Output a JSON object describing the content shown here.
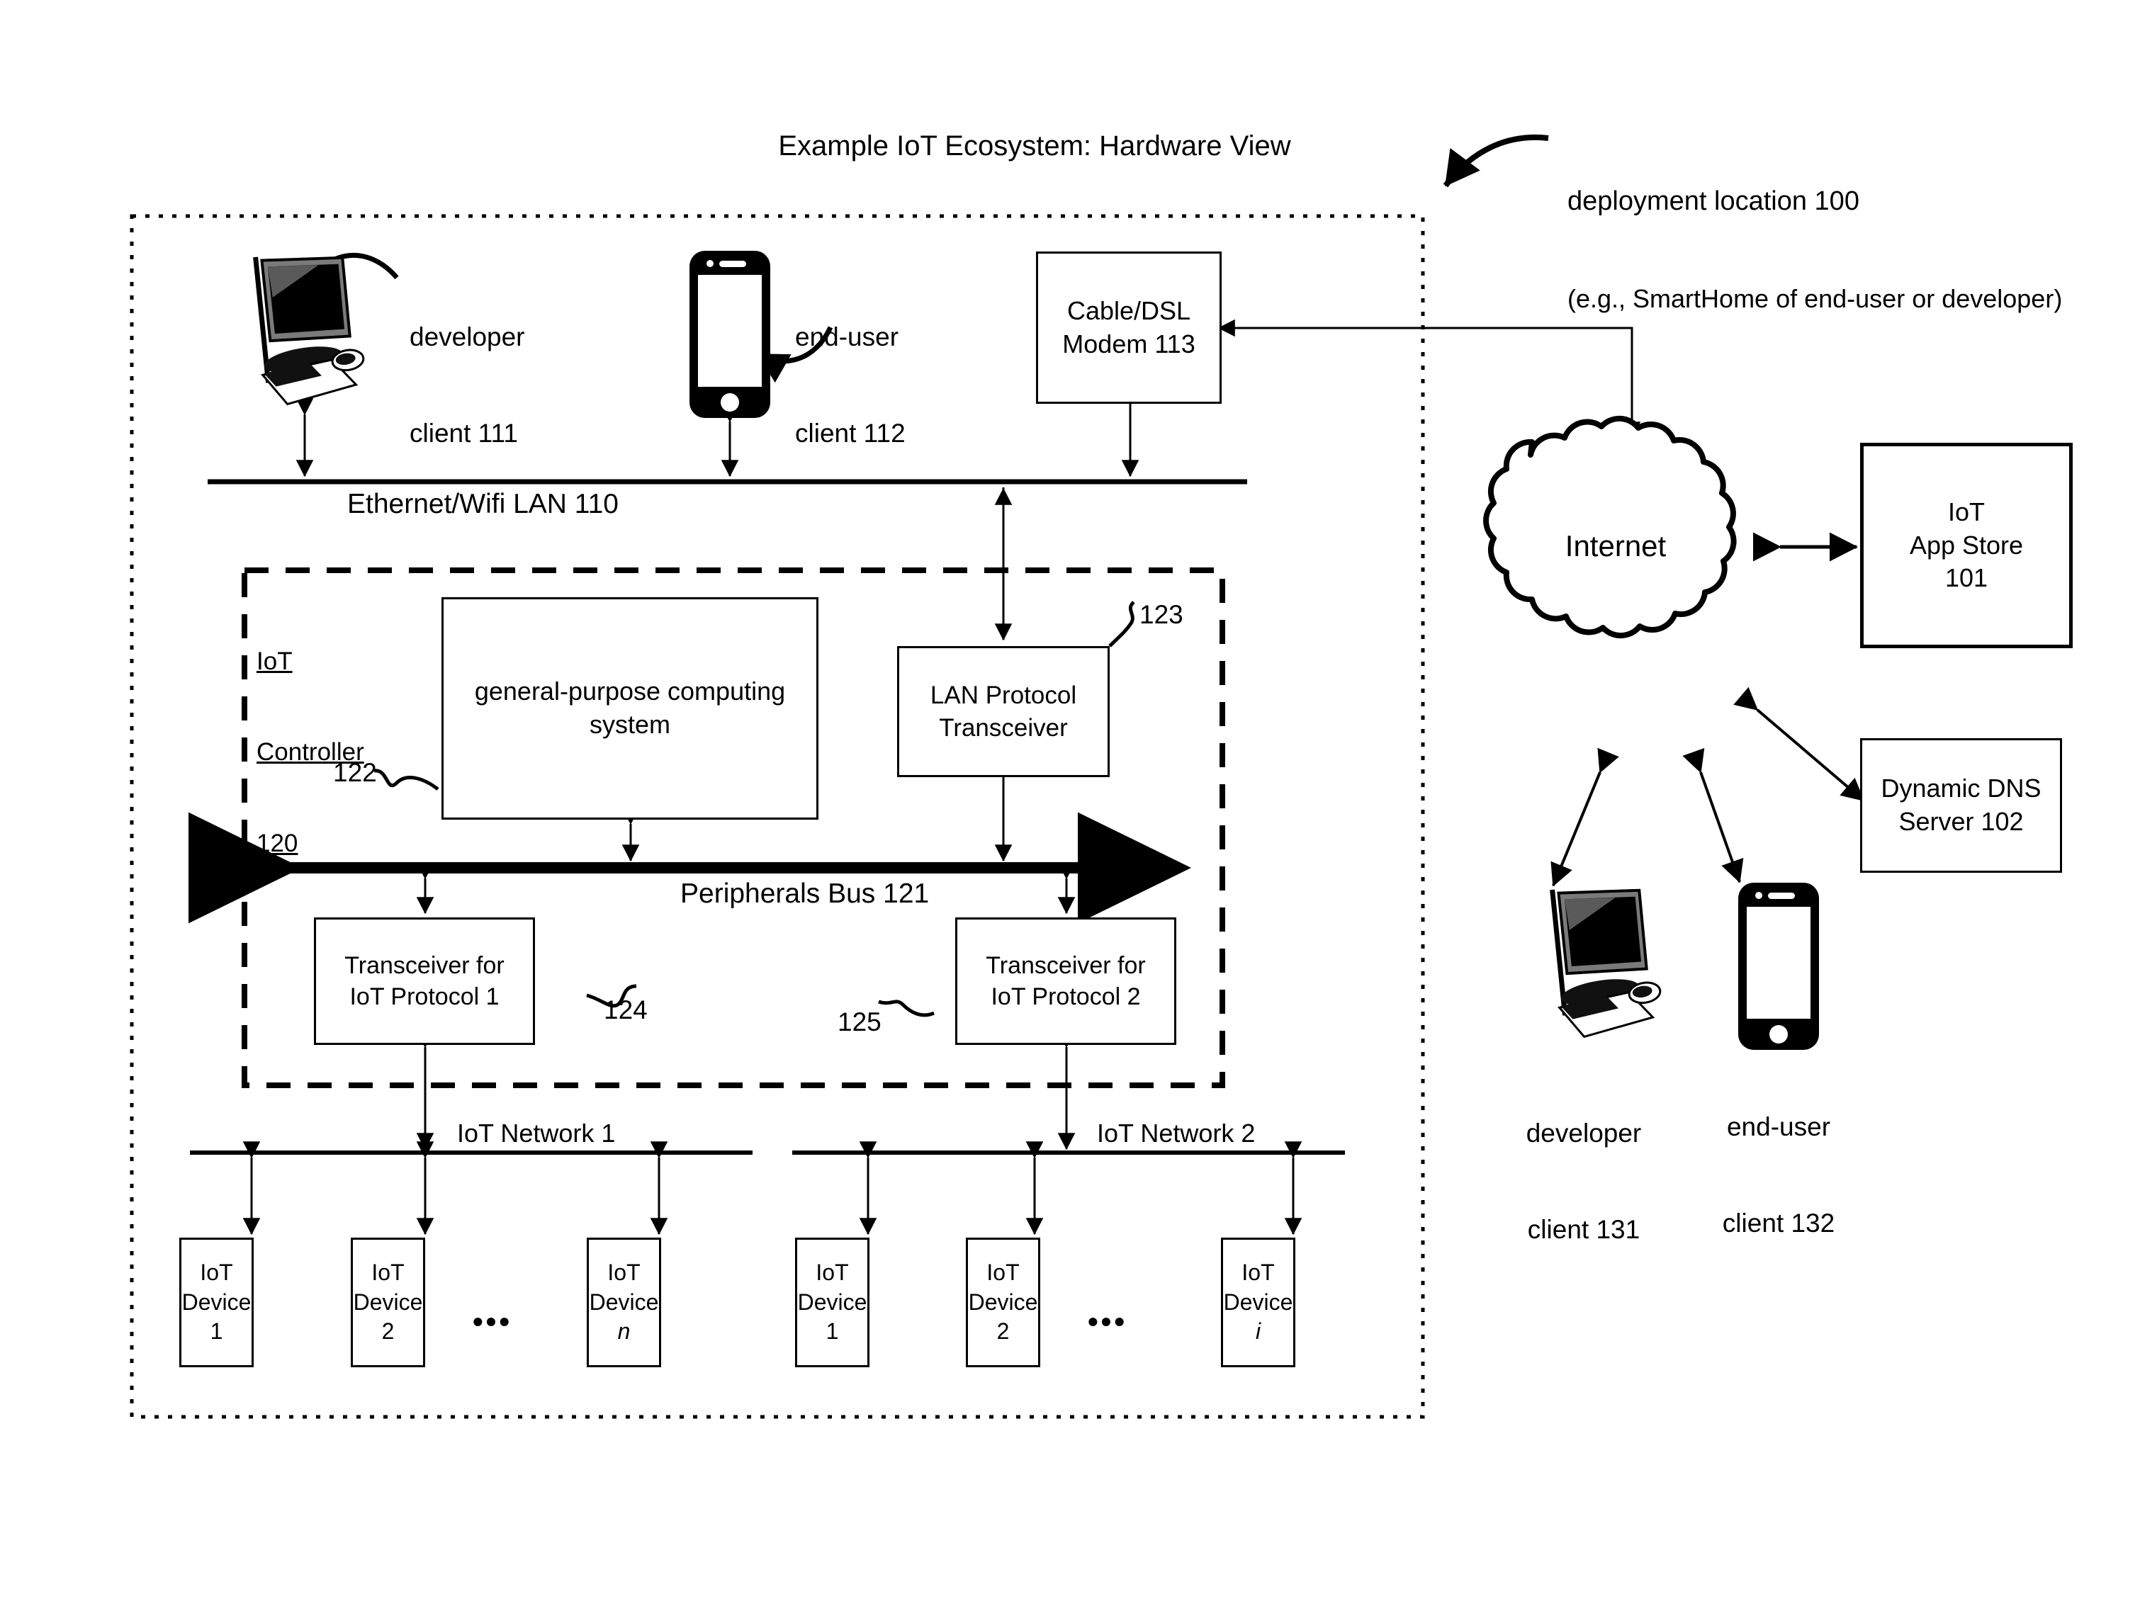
{
  "figure": {
    "title": "Example IoT Ecosystem: Hardware View",
    "deployment_label_line1": "deployment location 100",
    "deployment_label_line2": "(e.g., SmartHome of end-user or developer)"
  },
  "lan": {
    "label": "Ethernet/Wifi LAN 110"
  },
  "top_nodes": {
    "developer_client_line1": "developer",
    "developer_client_line2": "client 111",
    "end_user_client_line1": "end-user",
    "end_user_client_line2": "client 112",
    "modem_line1": "Cable/DSL",
    "modem_line2": "Modem 113"
  },
  "controller": {
    "title_line1": "IoT",
    "title_line2": "Controller",
    "title_line3": "120",
    "gpcs_line1": "general-purpose computing",
    "gpcs_line2": "system",
    "gpcs_ref": "122",
    "lan_transceiver_line1": "LAN Protocol",
    "lan_transceiver_line2": "Transceiver",
    "lan_transceiver_ref": "123",
    "bus_label": "Peripherals Bus 121",
    "transceiver1_line1": "Transceiver for",
    "transceiver1_line2": "IoT Protocol 1",
    "transceiver1_ref": "124",
    "transceiver2_line1": "Transceiver for",
    "transceiver2_line2": "IoT Protocol 2",
    "transceiver2_ref": "125"
  },
  "networks": [
    {
      "label": "IoT Network 1"
    },
    {
      "label": "IoT Network 2"
    }
  ],
  "devices_network1": [
    {
      "line1": "IoT",
      "line2": "Device 1",
      "italic_suffix": ""
    },
    {
      "line1": "IoT",
      "line2": "Device 2",
      "italic_suffix": ""
    },
    {
      "line1": "IoT",
      "line2": "Device ",
      "italic_suffix": "n"
    }
  ],
  "devices_network2": [
    {
      "line1": "IoT",
      "line2": "Device 1",
      "italic_suffix": ""
    },
    {
      "line1": "IoT",
      "line2": "Device 2",
      "italic_suffix": ""
    },
    {
      "line1": "IoT",
      "line2": "Device ",
      "italic_suffix": "i"
    }
  ],
  "ellipsis": "•••",
  "cloud": {
    "label": "Internet"
  },
  "servers": {
    "app_store_line1": "IoT",
    "app_store_line2": "App Store",
    "app_store_line3": "101",
    "dns_line1": "Dynamic DNS",
    "dns_line2": "Server 102"
  },
  "remote_clients": {
    "developer_line1": "developer",
    "developer_line2": "client 131",
    "end_user_line1": "end-user",
    "end_user_line2": "client 132"
  },
  "colors": {
    "ink": "#000000",
    "paper": "#ffffff"
  }
}
